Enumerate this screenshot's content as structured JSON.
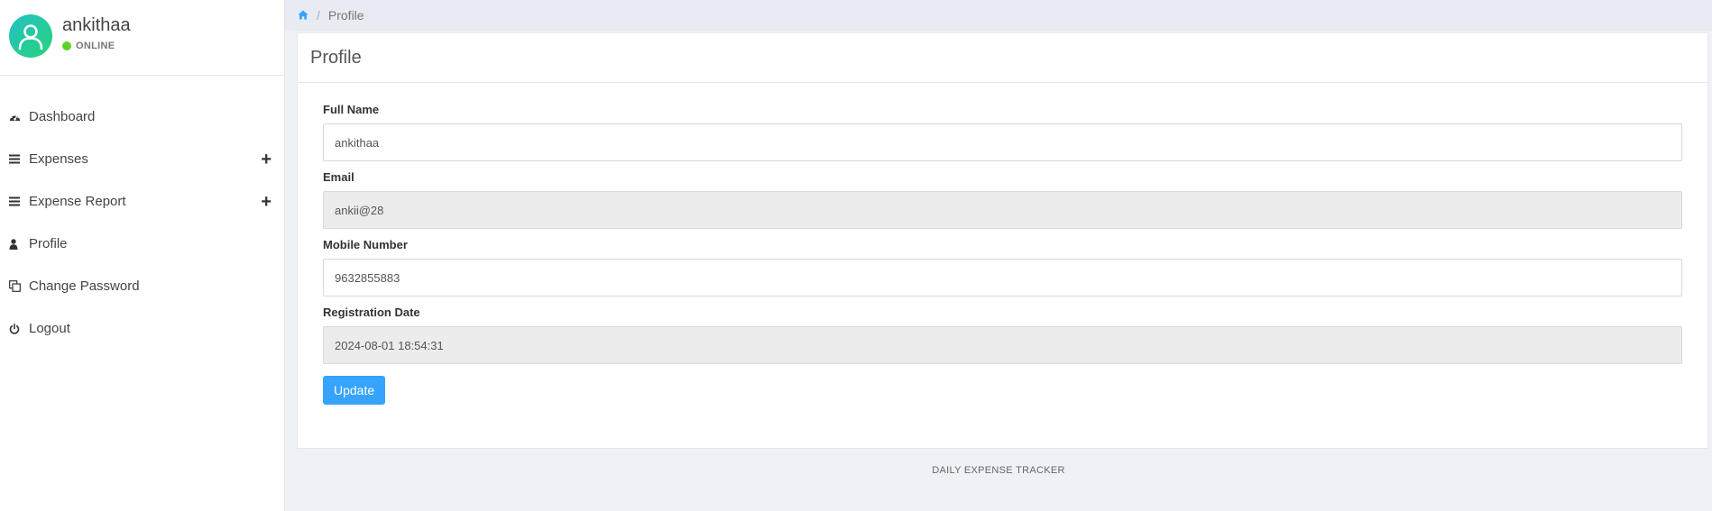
{
  "user": {
    "name": "ankithaa",
    "status": "ONLINE"
  },
  "sidebar": {
    "items": [
      {
        "label": "Dashboard",
        "icon": "dashboard-icon",
        "expandable": false
      },
      {
        "label": "Expenses",
        "icon": "list-icon",
        "expandable": true
      },
      {
        "label": "Expense Report",
        "icon": "list-icon",
        "expandable": true
      },
      {
        "label": "Profile",
        "icon": "user-icon",
        "expandable": false
      },
      {
        "label": "Change Password",
        "icon": "copy-icon",
        "expandable": false
      },
      {
        "label": "Logout",
        "icon": "power-icon",
        "expandable": false
      }
    ]
  },
  "breadcrumb": {
    "home_icon": "home-icon",
    "current": "Profile"
  },
  "card": {
    "title": "Profile"
  },
  "form": {
    "full_name": {
      "label": "Full Name",
      "value": "ankithaa"
    },
    "email": {
      "label": "Email",
      "value": "ankii@28"
    },
    "mobile": {
      "label": "Mobile Number",
      "value": "9632855883"
    },
    "registration_date": {
      "label": "Registration Date",
      "value": "2024-08-01 18:54:31"
    },
    "update_label": "Update"
  },
  "footer": {
    "text": "DAILY EXPENSE TRACKER"
  },
  "colors": {
    "accent": "#36a3ff",
    "online": "#5fd12a",
    "avatar_gradient_start": "#22c1c3",
    "avatar_gradient_end": "#27d37a"
  }
}
